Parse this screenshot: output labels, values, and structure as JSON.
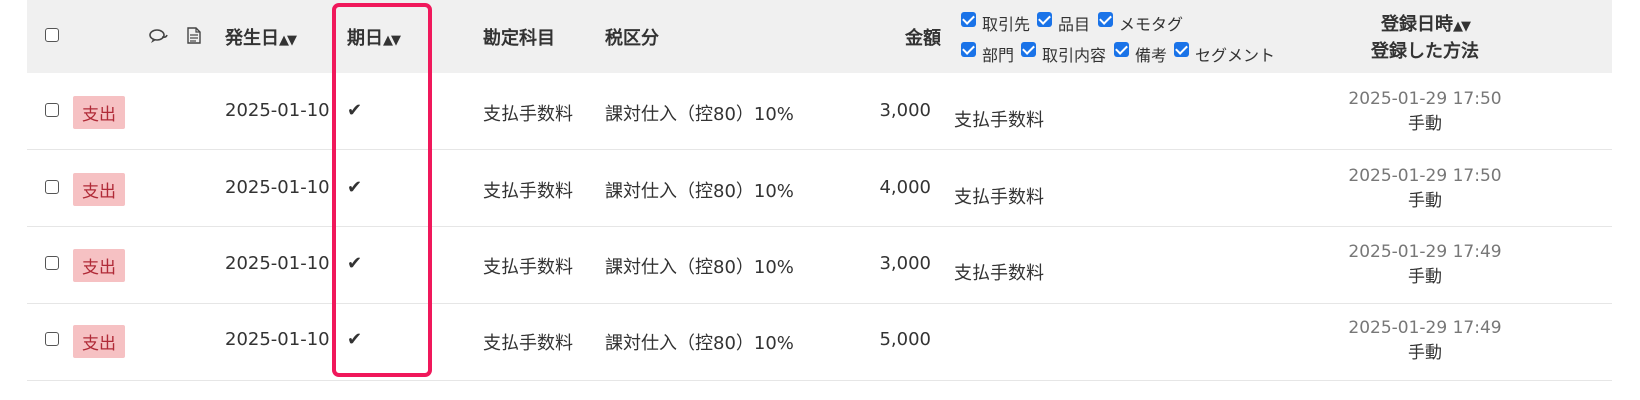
{
  "header": {
    "occurrence_date": "発生日",
    "period_date": "期日",
    "account": "勘定科目",
    "tax_category": "税区分",
    "amount": "金額",
    "registered_datetime": "登録日時",
    "registration_method": "登録した方法",
    "sort_glyph": "^v"
  },
  "column_toggles": [
    {
      "label": "取引先",
      "checked": true
    },
    {
      "label": "品目",
      "checked": true
    },
    {
      "label": "メモタグ",
      "checked": true
    },
    {
      "label": "部門",
      "checked": true
    },
    {
      "label": "取引内容",
      "checked": true
    },
    {
      "label": "備考",
      "checked": true
    },
    {
      "label": "セグメント",
      "checked": true
    }
  ],
  "rows": [
    {
      "type": "支出",
      "occurrence_date": "2025-01-10",
      "period": "✔",
      "account": "支払手数料",
      "tax": "課対仕入（控80）10%",
      "amount": "3,000",
      "detail": "支払手数料",
      "registered": "2025-01-29 17:50",
      "method": "手動"
    },
    {
      "type": "支出",
      "occurrence_date": "2025-01-10",
      "period": "✔",
      "account": "支払手数料",
      "tax": "課対仕入（控80）10%",
      "amount": "4,000",
      "detail": "支払手数料",
      "registered": "2025-01-29 17:50",
      "method": "手動"
    },
    {
      "type": "支出",
      "occurrence_date": "2025-01-10",
      "period": "✔",
      "account": "支払手数料",
      "tax": "課対仕入（控80）10%",
      "amount": "3,000",
      "detail": "支払手数料",
      "registered": "2025-01-29 17:49",
      "method": "手動"
    },
    {
      "type": "支出",
      "occurrence_date": "2025-01-10",
      "period": "✔",
      "account": "支払手数料",
      "tax": "課対仕入（控80）10%",
      "amount": "5,000",
      "detail": "",
      "registered": "2025-01-29 17:49",
      "method": "手動"
    }
  ],
  "colors": {
    "highlight": "#f0185b",
    "badge_bg": "#f6c1c3",
    "badge_text": "#b02a37",
    "header_bg": "#f0f0f0"
  }
}
